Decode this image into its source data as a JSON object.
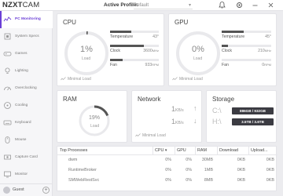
{
  "app": {
    "logo_bold": "NZXT",
    "logo_light": "CAM",
    "active_profile_label": "Active Profile:",
    "active_profile_value": "Default"
  },
  "sidebar": {
    "items": [
      {
        "label": "PC Monitoring",
        "icon": "monitoring-icon",
        "active": true
      },
      {
        "label": "System Specs",
        "icon": "specs-icon"
      },
      {
        "label": "Games",
        "icon": "games-icon"
      },
      {
        "label": "Lighting",
        "icon": "lighting-icon"
      },
      {
        "label": "Overclocking",
        "icon": "overclocking-icon"
      },
      {
        "label": "Cooling",
        "icon": "cooling-icon"
      },
      {
        "label": "Keyboard",
        "icon": "keyboard-icon"
      },
      {
        "label": "Mouse",
        "icon": "mouse-icon"
      },
      {
        "label": "Capture Card",
        "icon": "capture-card-icon"
      },
      {
        "label": "Monitor",
        "icon": "monitor-icon"
      }
    ],
    "user_label": "Guest"
  },
  "cpu": {
    "title": "CPU",
    "load_value": "1%",
    "load_label": "Load",
    "load_fraction": 0.01,
    "temperature_label": "Temperature",
    "temperature_value": "43°",
    "temperature_fraction": 0.43,
    "clock_label": "Clock",
    "clock_value": "3600",
    "clock_unit": "MHz",
    "clock_fraction": 0.7,
    "fan_label": "Fan",
    "fan_value": "933",
    "fan_unit": "RPM",
    "fan_fraction": 0.25,
    "footnote": "Minimal Load"
  },
  "gpu": {
    "title": "GPU",
    "load_value": "0%",
    "load_label": "Load",
    "load_fraction": 0.0,
    "temperature_label": "Temperature",
    "temperature_value": "45°",
    "temperature_fraction": 0.45,
    "clock_label": "Clock",
    "clock_value": "210",
    "clock_unit": "MHz",
    "clock_fraction": 0.12,
    "fan_label": "Fan",
    "fan_value": "0",
    "fan_unit": "RPM",
    "fan_fraction": 0.0,
    "footnote": "Minimal Load"
  },
  "ram": {
    "title": "RAM",
    "load_value": "19%",
    "load_label": "Load",
    "load_fraction": 0.19
  },
  "network": {
    "title": "Network",
    "upload_value": "1",
    "download_value": "1",
    "unit": "KB/s",
    "footnote": "Minimal Load"
  },
  "storage": {
    "title": "Storage",
    "drives": [
      {
        "letter": "C:\\",
        "label": "886GB / 932GB"
      },
      {
        "letter": "H:\\",
        "label": "3.5TB / 3.6TB"
      }
    ]
  },
  "processes": {
    "columns": [
      "Top Processes",
      "CPU",
      "GPU",
      "RAM",
      "Download",
      "Upload"
    ],
    "rows": [
      {
        "name": "dwm",
        "cpu": "0%",
        "gpu": "0%",
        "ram": "30MB",
        "download": "0KB",
        "upload": "0KB"
      },
      {
        "name": "RuntimeBroker",
        "cpu": "0%",
        "gpu": "0%",
        "ram": "1MB",
        "download": "0KB",
        "upload": "0KB"
      },
      {
        "name": "SMWebRestSvc",
        "cpu": "0%",
        "gpu": "0%",
        "ram": "8MB",
        "download": "0KB",
        "upload": "0KB"
      }
    ]
  }
}
